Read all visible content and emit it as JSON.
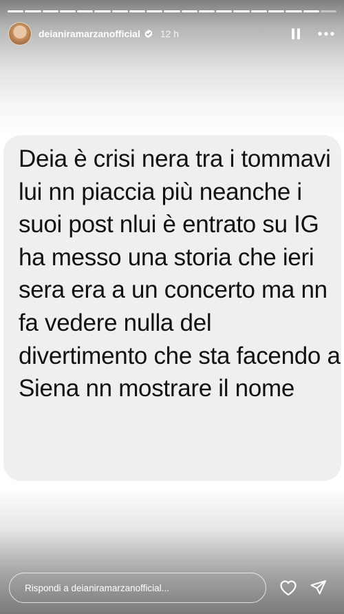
{
  "story": {
    "progress": {
      "segments_total": 19,
      "segments_seen": 18
    },
    "header": {
      "username": "deianiramarzanofficial",
      "verified": true,
      "time_ago": "12 h",
      "pause_icon": "pause-icon",
      "more_icon": "more-horizontal-icon"
    },
    "message": {
      "text": "Deia è crisi nera tra i tommavi lui nn piaccia più neanche i suoi post nlui è entrato su IG ha messo una storia che ieri sera era a un concerto ma nn fa vedere nulla del divertimento che sta facendo a Siena nn mostrare il nome"
    },
    "footer": {
      "reply_placeholder": "Rispondi a deianiramarzanofficial...",
      "like_icon": "heart-icon",
      "share_icon": "send-icon"
    }
  },
  "colors": {
    "card_background": "#efeff1",
    "text": "#111111",
    "overlay_text": "#ffffff"
  }
}
